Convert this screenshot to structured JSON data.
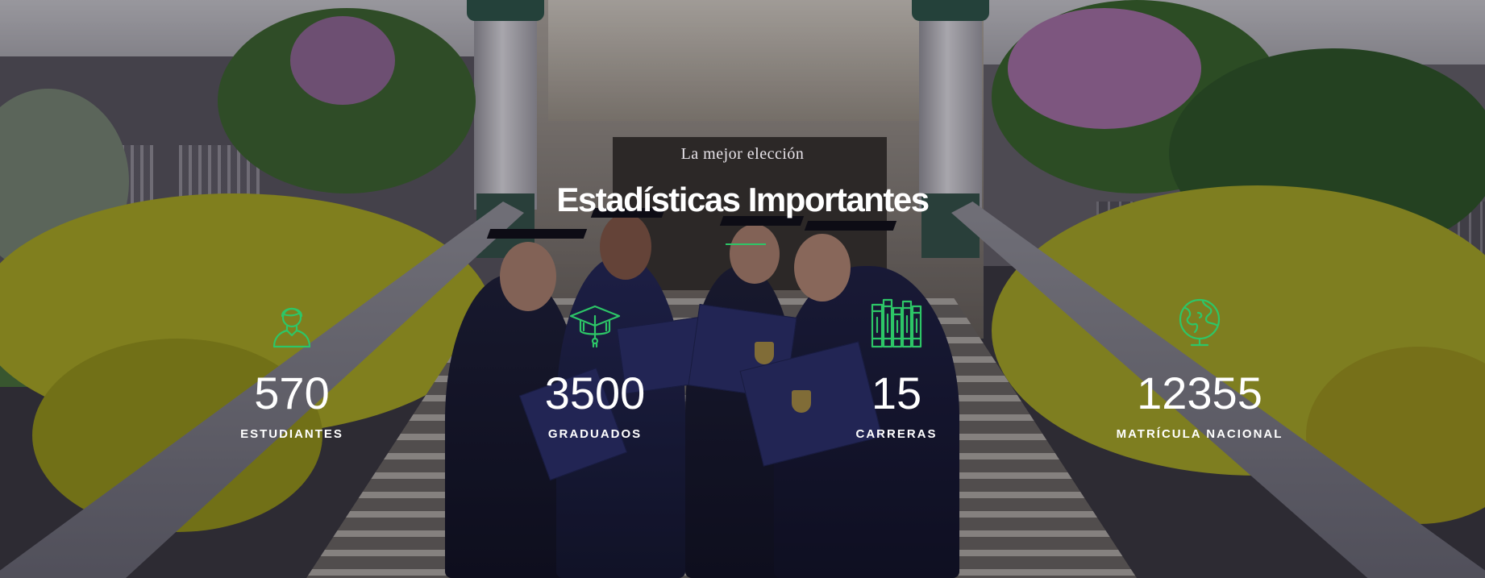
{
  "section": {
    "eyebrow": "La mejor elección",
    "title": "Estadísticas Importantes",
    "accent_color": "#2dc667"
  },
  "stats": [
    {
      "icon": "student-avatar-icon",
      "value": "570",
      "label": "ESTUDIANTES"
    },
    {
      "icon": "graduation-cap-icon",
      "value": "3500",
      "label": "GRADUADOS"
    },
    {
      "icon": "books-icon",
      "value": "15",
      "label": "CARRERAS"
    },
    {
      "icon": "globe-icon",
      "value": "12355",
      "label": "MATRÍCULA NACIONAL"
    }
  ]
}
